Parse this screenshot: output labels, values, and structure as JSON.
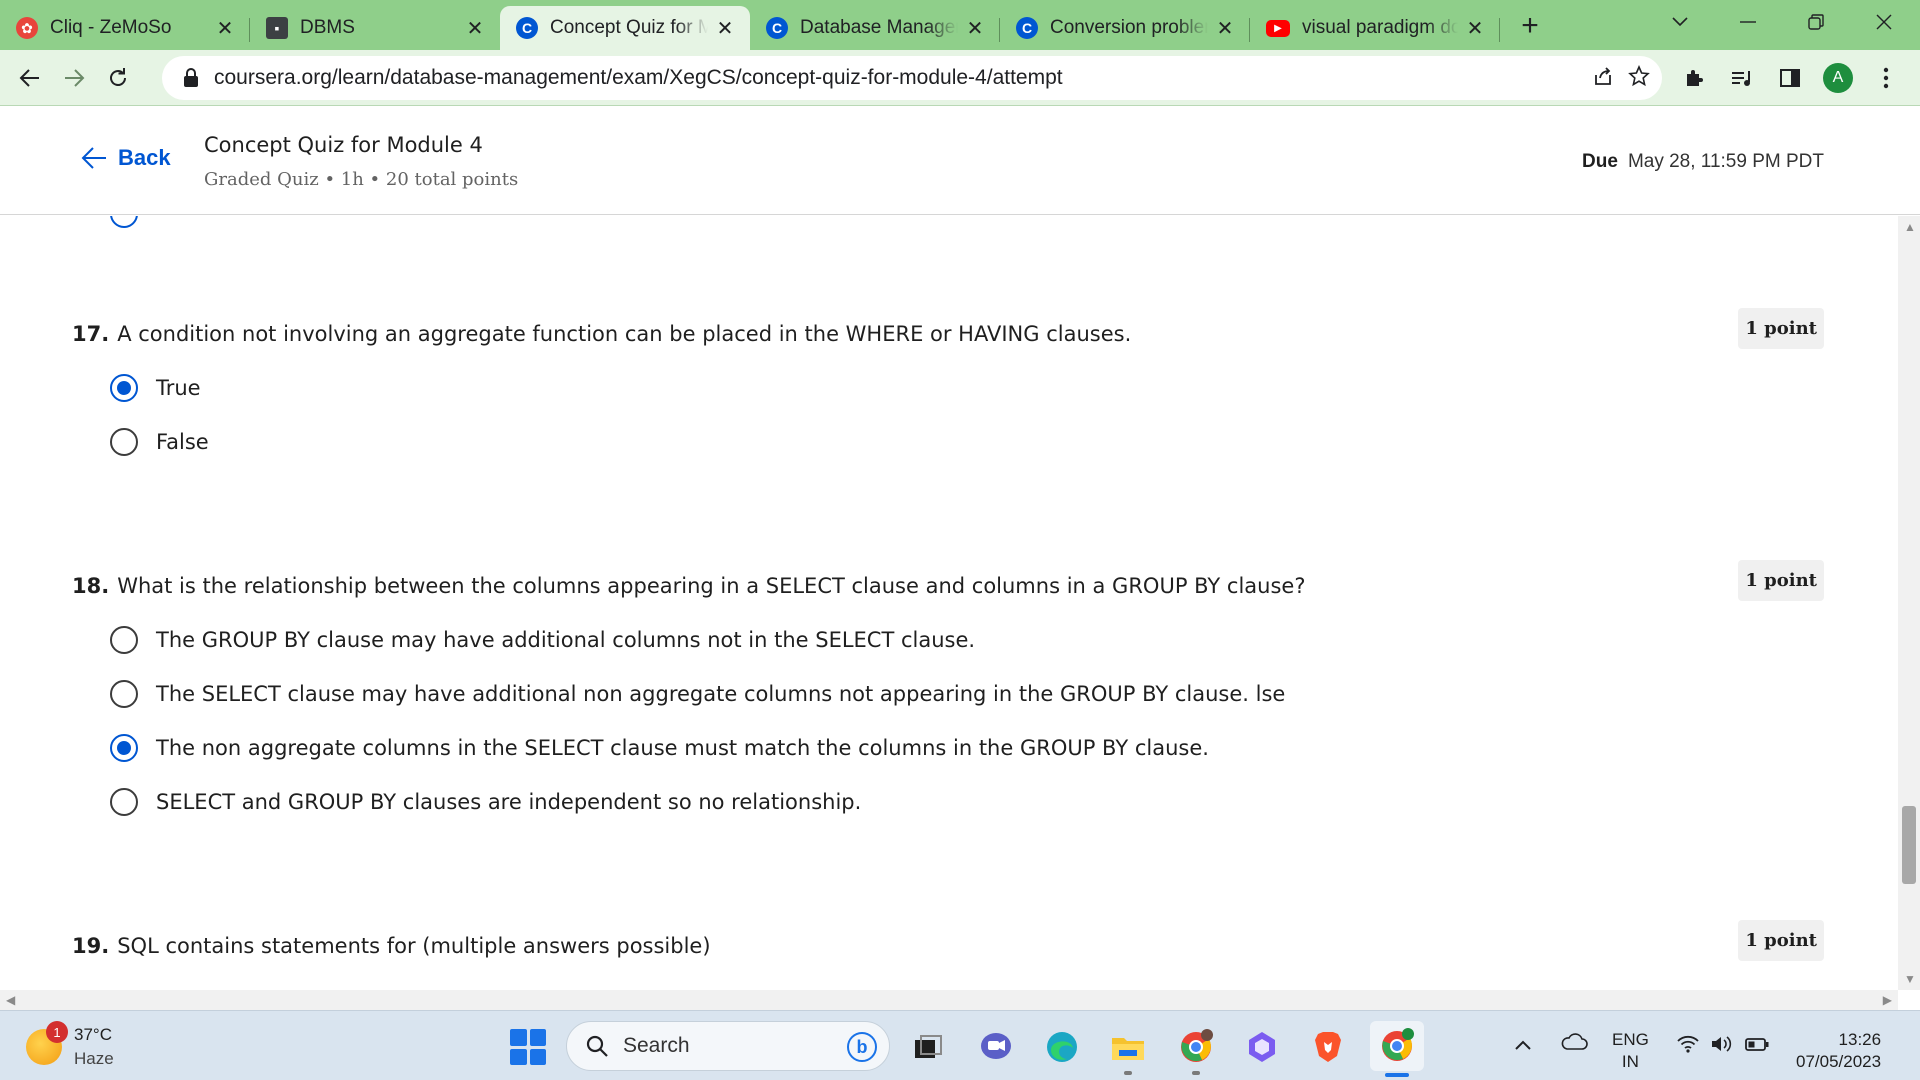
{
  "browser": {
    "tabs": [
      {
        "title": "Cliq - ZeMoSo",
        "icon": "zoho-cliq-icon",
        "active": false
      },
      {
        "title": "DBMS",
        "icon": "classroom-icon",
        "active": false
      },
      {
        "title": "Concept Quiz for M",
        "icon": "coursera-icon",
        "active": true
      },
      {
        "title": "Database Managem",
        "icon": "coursera-icon",
        "active": false
      },
      {
        "title": "Conversion problem",
        "icon": "coursera-icon",
        "active": false
      },
      {
        "title": "visual paradigm do",
        "icon": "youtube-icon",
        "active": false
      }
    ],
    "url": "coursera.org/learn/database-management/exam/XegCS/concept-quiz-for-module-4/attempt",
    "profile_initial": "A"
  },
  "quiz": {
    "back_label": "Back",
    "title": "Concept Quiz for Module 4",
    "subtitle": "Graded Quiz • 1h • 20 total points",
    "due_label": "Due",
    "due_value": "May 28, 11:59 PM PDT"
  },
  "questions": [
    {
      "number": "17.",
      "text": "A condition not involving an aggregate function can be placed in the WHERE or HAVING clauses.",
      "points": "1 point",
      "options": [
        {
          "label": "True",
          "selected": true
        },
        {
          "label": "False",
          "selected": false
        }
      ]
    },
    {
      "number": "18.",
      "text": "What is the relationship between the columns appearing in a SELECT clause and columns in a GROUP BY clause?",
      "points": "1 point",
      "options": [
        {
          "label": "The GROUP BY clause may have additional columns not in the SELECT clause.",
          "selected": false
        },
        {
          "label": "The SELECT clause may have additional non aggregate columns not appearing in the GROUP BY clause. lse",
          "selected": false
        },
        {
          "label": "The non aggregate columns in the SELECT clause must match the columns in the GROUP BY clause.",
          "selected": true
        },
        {
          "label": "SELECT and GROUP BY clauses are independent so no relationship.",
          "selected": false
        }
      ]
    },
    {
      "number": "19.",
      "text": "SQL contains statements for (multiple answers possible)",
      "points": "1 point",
      "options": []
    }
  ],
  "taskbar": {
    "weather_temp": "37°C",
    "weather_cond": "Haze",
    "weather_badge": "1",
    "search_label": "Search",
    "lang_line1": "ENG",
    "lang_line2": "IN",
    "time": "13:26",
    "date": "07/05/2023"
  },
  "colors": {
    "tabstrip": "#8fcf8a",
    "toolbar": "#e6f4e4",
    "accent": "#0056d2"
  }
}
